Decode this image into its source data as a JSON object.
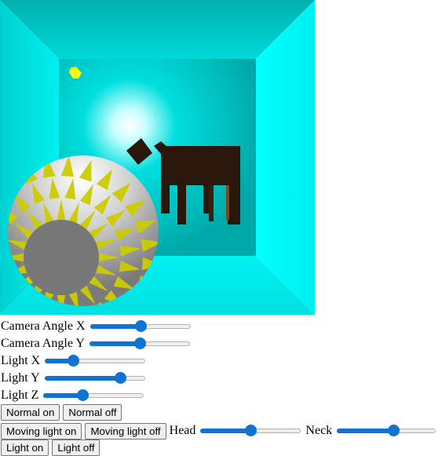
{
  "scene": {
    "colors": {
      "room_wall": "#00e6e6",
      "room_back": "#00bcbc",
      "dog": "#2a170c",
      "ball_yellow": "#d4d400",
      "ball_white": "#eeeeee",
      "ball_face": "#777777",
      "light_marker": "#ffff00"
    }
  },
  "controls": {
    "camera_x": {
      "label": "Camera Angle X",
      "value": 0.5
    },
    "camera_y": {
      "label": "Camera Angle Y",
      "value": 0.5
    },
    "light_x": {
      "label": "Light X",
      "value": 0.25
    },
    "light_y": {
      "label": "Light Y",
      "value": 0.78
    },
    "light_z": {
      "label": "Light Z",
      "value": 0.37
    }
  },
  "buttons": {
    "normal_on": "Normal on",
    "normal_off": "Normal off",
    "moving_light_on": "Moving light on",
    "moving_light_off": "Moving light off",
    "light_on": "Light on",
    "light_off": "Light off"
  },
  "head": {
    "label": "Head",
    "value": 0.5
  },
  "neck": {
    "label": "Neck",
    "value": 0.58
  }
}
